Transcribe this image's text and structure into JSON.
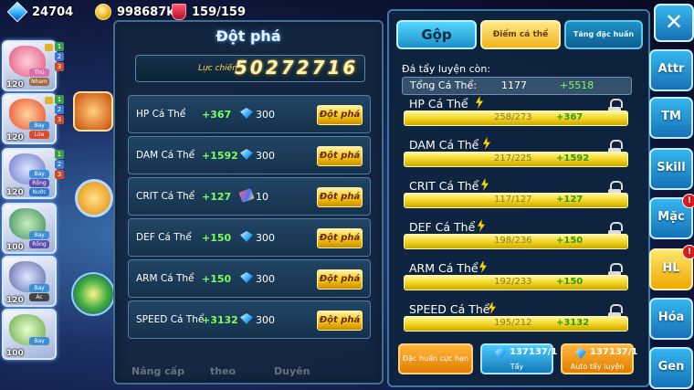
{
  "topbar": {
    "gems": "24704",
    "gold": "998687k",
    "stamina": "159/159"
  },
  "pets": [
    {
      "level": "120",
      "type1": "Thú",
      "type2": "Nham",
      "nums": [
        "1",
        "2",
        "3"
      ],
      "color": "#e2557a"
    },
    {
      "level": "120",
      "type1": "Bay",
      "type2": "Lửa",
      "nums": [
        "1",
        "2",
        "3"
      ],
      "color": "#e84b2c"
    },
    {
      "level": "120",
      "type1": "Bay",
      "type2": "Rồng",
      "type3": "Nước",
      "nums": [
        "1",
        "2",
        "3"
      ],
      "color": "#6b78c9"
    },
    {
      "level": "100",
      "type1": "Bay",
      "type2": "Rồng",
      "nums": [],
      "color": "#3c8a58"
    },
    {
      "level": "120",
      "type1": "Bay",
      "type2": "Ác",
      "nums": [],
      "color": "#5a6aa8"
    },
    {
      "level": "100",
      "type1": "Bay",
      "nums": [],
      "color": "#6aa84a"
    }
  ],
  "left_panel": {
    "title": "Đột phá",
    "power_label": "Lực chiến",
    "power_value": "50272716",
    "rows": [
      {
        "name": "HP Cá Thể",
        "bonus": "+367",
        "cost": "300",
        "cost_icon": "diamond-icon",
        "button": "Đột phá"
      },
      {
        "name": "DAM Cá Thể",
        "bonus": "+1592",
        "cost": "300",
        "cost_icon": "diamond-icon",
        "button": "Đột phá"
      },
      {
        "name": "CRIT Cá Thể",
        "bonus": "+127",
        "cost": "10",
        "cost_icon": "scroll-icon",
        "button": "Đột phá"
      },
      {
        "name": "DEF Cá Thể",
        "bonus": "+150",
        "cost": "300",
        "cost_icon": "diamond-icon",
        "button": "Đột phá"
      },
      {
        "name": "ARM Cá Thể",
        "bonus": "+150",
        "cost": "300",
        "cost_icon": "diamond-icon",
        "button": "Đột phá"
      },
      {
        "name": "SPEED Cá Thể",
        "bonus": "+3132",
        "cost": "300",
        "cost_icon": "diamond-icon",
        "button": "Đột phá"
      }
    ],
    "bottom_tabs": [
      "Nâng cấp",
      "theo",
      "Duyên"
    ]
  },
  "right_panel": {
    "tabs": [
      "Gộp",
      "Điểm cá thể",
      "Tăng đặc huấn"
    ],
    "subhead": "Đá tẩy luyện còn:",
    "total_label": "Tổng Cá Thể:",
    "total_value": "1177",
    "total_bonus": "+5518",
    "stats": [
      {
        "name": "HP Cá Thể",
        "value": "258/273",
        "bonus": "+367",
        "fill": 0.945
      },
      {
        "name": "DAM Cá Thể",
        "value": "217/225",
        "bonus": "+1592",
        "fill": 0.964
      },
      {
        "name": "CRIT Cá Thể",
        "value": "117/127",
        "bonus": "+127",
        "fill": 0.921
      },
      {
        "name": "DEF Cá Thể",
        "value": "198/236",
        "bonus": "+150",
        "fill": 0.839
      },
      {
        "name": "ARM Cá Thể",
        "value": "192/233",
        "bonus": "+150",
        "fill": 0.824
      },
      {
        "name": "SPEED Cá Thể",
        "value": "195/212",
        "bonus": "+3132",
        "fill": 0.92
      }
    ],
    "buttons": {
      "special": "Đặc huấn cực hạn",
      "wash_count": "137137/1",
      "wash_label": "Tẩy",
      "auto_count": "137137/1",
      "auto_label": "Auto tẩy luyện"
    }
  },
  "side_buttons": [
    {
      "label": "Attr",
      "badge": ""
    },
    {
      "label": "TM",
      "badge": ""
    },
    {
      "label": "Skill",
      "badge": ""
    },
    {
      "label": "Mặc",
      "badge": "!"
    },
    {
      "label": "HL",
      "badge": "!"
    },
    {
      "label": "Hóa",
      "badge": ""
    },
    {
      "label": "Gen",
      "badge": ""
    }
  ],
  "close_label": "✕"
}
